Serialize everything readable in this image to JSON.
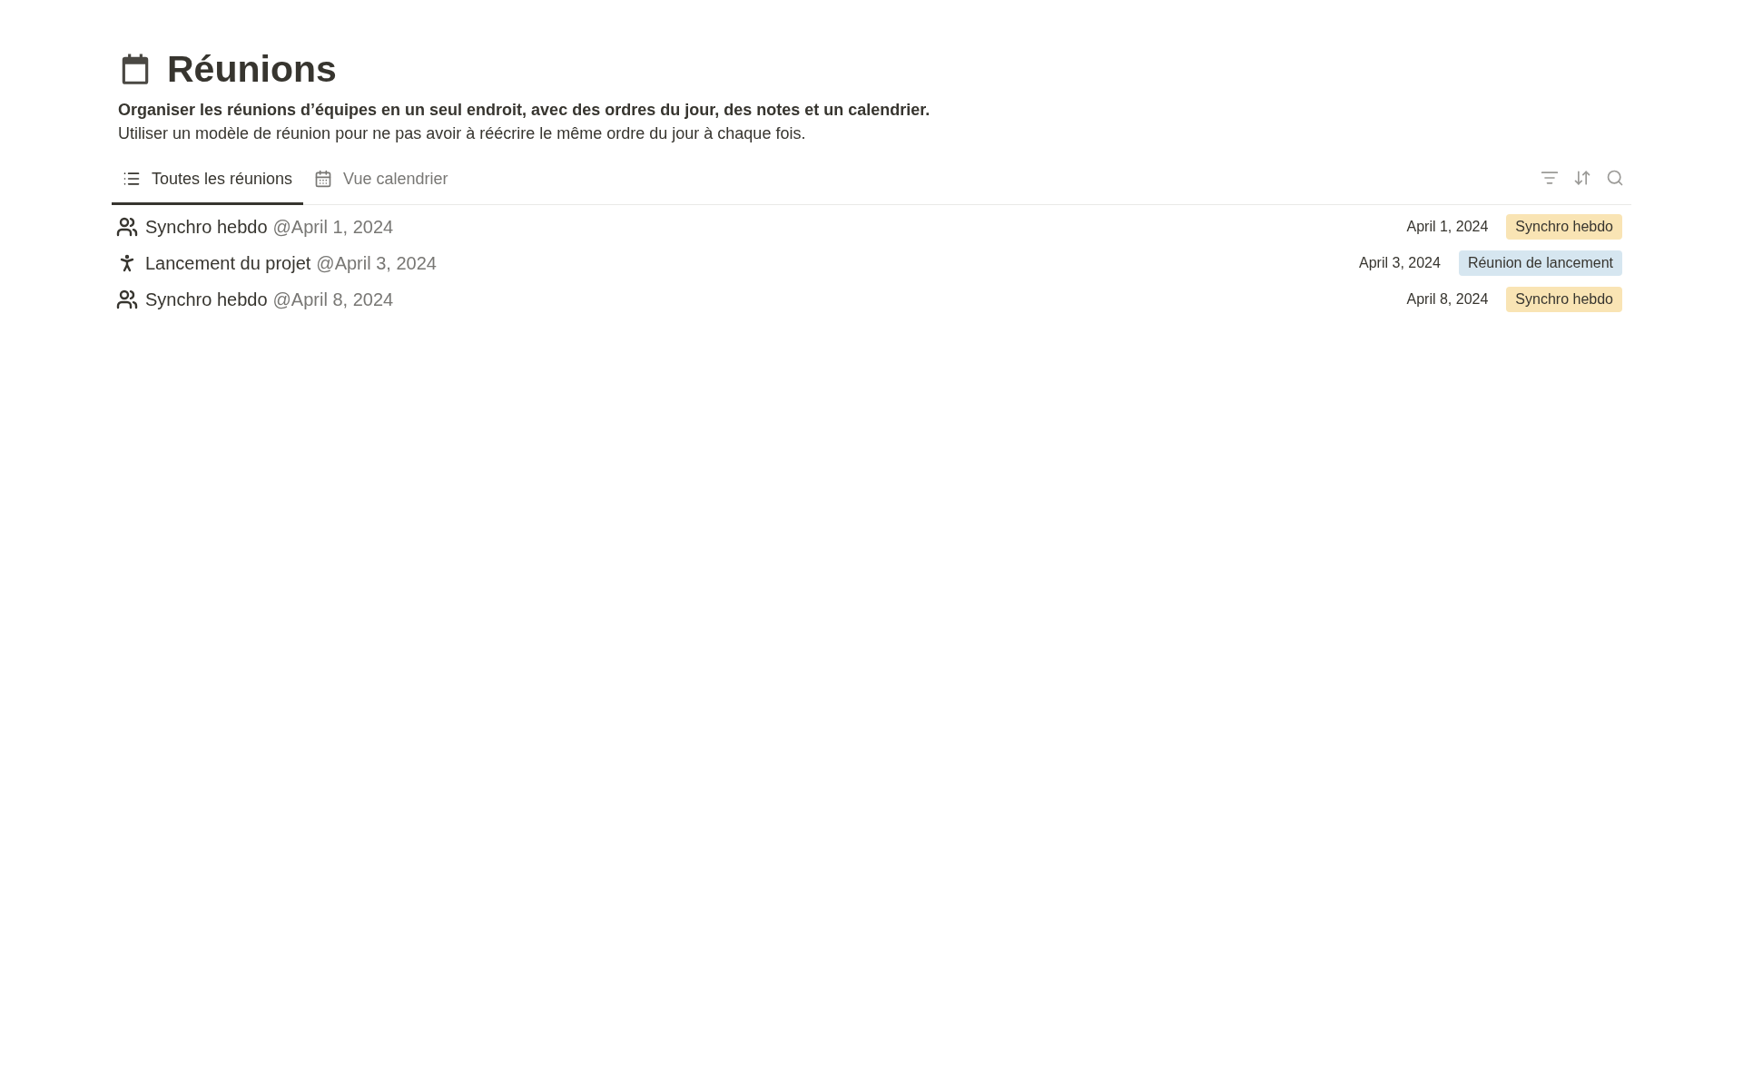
{
  "page": {
    "title": "Réunions",
    "description_bold": "Organiser les réunions d’équipes en un seul endroit, avec des ordres du jour, des notes et un calendrier.",
    "description": "Utiliser un modèle de réunion pour ne pas avoir à réécrire le même ordre du jour à chaque fois."
  },
  "tabs": [
    {
      "label": "Toutes les réunions",
      "kind": "list",
      "selected": true
    },
    {
      "label": "Vue calendrier",
      "kind": "calendar",
      "selected": false
    }
  ],
  "rows": [
    {
      "kind": "people",
      "title": "Synchro hebdo",
      "mention": "@April 1, 2024",
      "date": "April 1, 2024",
      "tag": "Synchro hebdo",
      "color": "#f9e4b4"
    },
    {
      "kind": "runner",
      "title": "Lancement du projet",
      "mention": "@April 3, 2024",
      "date": "April 3, 2024",
      "tag": "Réunion de lancement",
      "color": "#d6e6f0"
    },
    {
      "kind": "people",
      "title": "Synchro hebdo",
      "mention": "@April 8, 2024",
      "date": "April 8, 2024",
      "tag": "Synchro hebdo",
      "color": "#f9e4b4"
    }
  ]
}
